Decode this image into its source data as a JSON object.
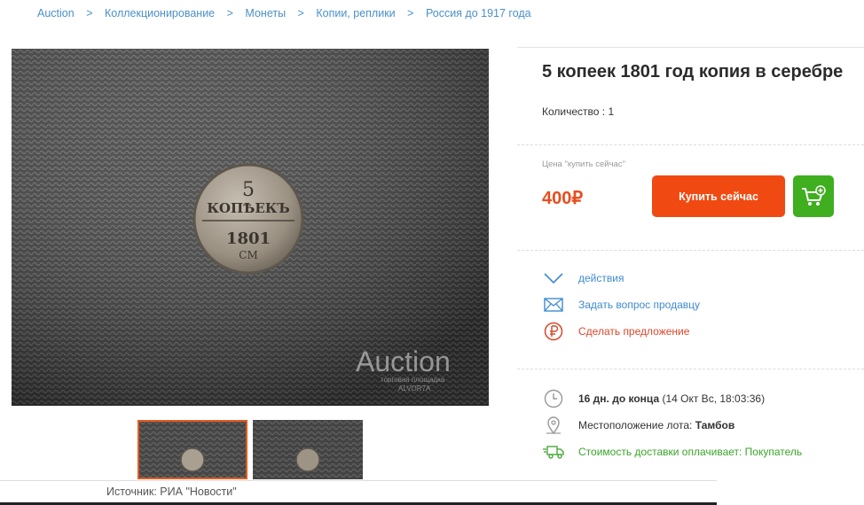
{
  "breadcrumbs": [
    "Auction",
    "Коллекционирование",
    "Монеты",
    "Копии, реплики",
    "Россия до 1917 года"
  ],
  "breadcrumb_sep": ">",
  "lot": {
    "title": "5 копеек 1801 год копия в серебре",
    "quantity": "Количество : 1",
    "price_label": "Цена \"купить сейчас\"",
    "price": "400₽",
    "buy_label": "Купить сейчас"
  },
  "actions": [
    {
      "label": "действия",
      "icon": "chevron-down-icon"
    },
    {
      "label": "Задать вопрос продавцу",
      "icon": "envelope-icon"
    },
    {
      "label": "Сделать предложение",
      "icon": "ruble-circle-icon"
    }
  ],
  "info": {
    "time_bold": "16 дн. до конца",
    "time_rest": " (14 Окт Вс, 18:03:36)",
    "location_label": "Местоположение лота: ",
    "location_value": "Тамбов",
    "shipping": "Стоимость доставки оплачивает: Покупатель"
  },
  "photo": {
    "coin_denom": "5",
    "coin_word": "КОПѢЕКЪ",
    "coin_year": "1801",
    "coin_mint": "СМ",
    "watermark": "Auction",
    "watermark_sub": "торговая площадка",
    "watermark_sub2": "ALVOR7A"
  },
  "source": "Источник: РИА \"Новости\"",
  "colors": {
    "accent": "#f04a12",
    "price": "#e84c1e",
    "link": "#3f8bd0",
    "green": "#3fae1f"
  }
}
